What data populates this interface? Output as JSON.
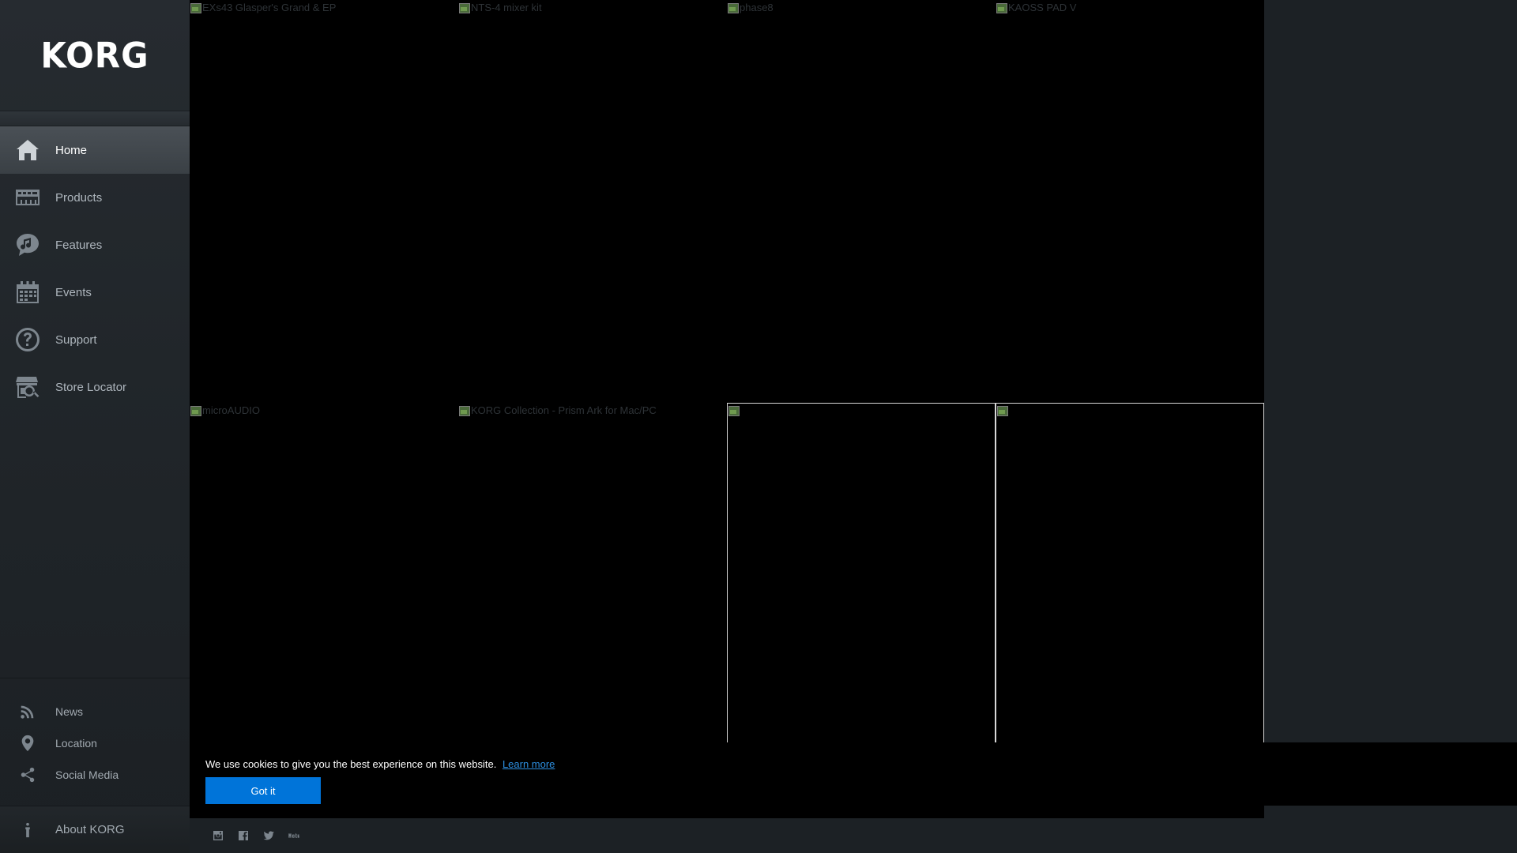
{
  "brand": {
    "logo_text": "KORG"
  },
  "nav": {
    "items": [
      {
        "label": "Home",
        "icon": "home-icon",
        "active": true
      },
      {
        "label": "Products",
        "icon": "keyboard-icon"
      },
      {
        "label": "Features",
        "icon": "music-note-icon"
      },
      {
        "label": "Events",
        "icon": "calendar-icon"
      },
      {
        "label": "Support",
        "icon": "question-icon"
      },
      {
        "label": "Store Locator",
        "icon": "store-search-icon"
      }
    ]
  },
  "sub_nav": {
    "items": [
      {
        "label": "News",
        "icon": "rss-icon"
      },
      {
        "label": "Location",
        "icon": "location-pin-icon"
      },
      {
        "label": "Social Media",
        "icon": "share-icon"
      }
    ]
  },
  "about": {
    "label": "About KORG",
    "icon": "about-icon"
  },
  "tiles": [
    {
      "alt": "EXs43 Glasper's Grand & EP"
    },
    {
      "alt": "NTS-4 mixer kit"
    },
    {
      "alt": "phase8"
    },
    {
      "alt": "KAOSS PAD V"
    },
    {
      "alt": "microAUDIO"
    },
    {
      "alt": "KORG Collection - Prism Ark for Mac/PC"
    },
    {
      "alt": ""
    },
    {
      "alt": ""
    }
  ],
  "cookie": {
    "message": "We use cookies to give you the best experience on this website.",
    "link": "Learn more",
    "button": "Got it"
  },
  "social": [
    "instagram-icon",
    "facebook-icon",
    "twitter-icon",
    "youtube-icon"
  ]
}
